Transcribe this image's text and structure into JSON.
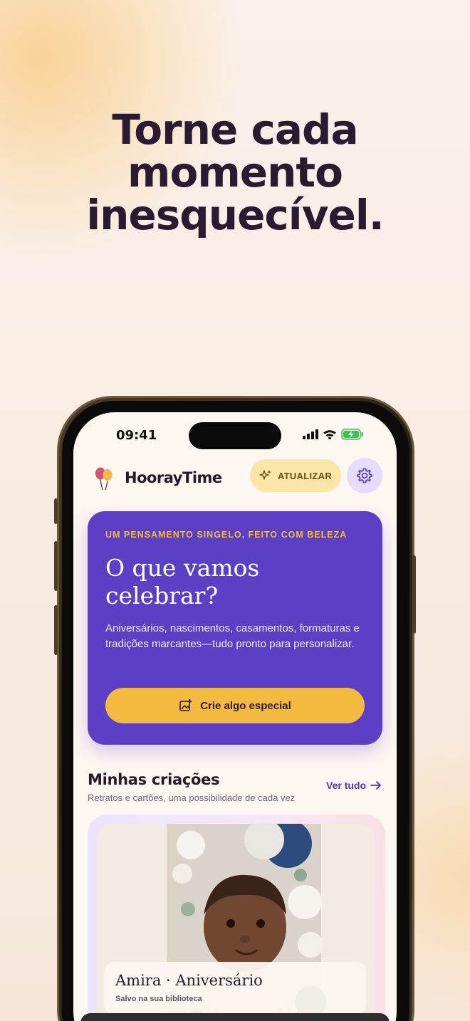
{
  "headline": {
    "line1": "Torne cada",
    "line2": "momento",
    "line3": "inesquecível."
  },
  "status_bar": {
    "time": "09:41"
  },
  "app": {
    "brand": "HoorayTime",
    "upgrade_label": "ATUALIZAR",
    "settings_icon": "gear-icon"
  },
  "hero": {
    "eyebrow": "UM PENSAMENTO SINGELO, FEITO COM BELEZA",
    "title_line1": "O que vamos",
    "title_line2": "celebrar?",
    "description": "Aniversários, nascimentos, casamentos, formaturas e tradições marcantes—tudo pronto para personalizar.",
    "cta_label": "Crie algo especial"
  },
  "creations": {
    "title": "Minhas criações",
    "subtitle": "Retratos e cartões, uma possibilidade de cada vez",
    "see_all": "Ver tudo",
    "card": {
      "title": "Amira · Aniversário",
      "subtitle": "Salvo na sua biblioteca"
    }
  },
  "colors": {
    "primary": "#5b40c6",
    "accent": "#f4b93f",
    "upgrade_bg": "#fbe6a9",
    "settings_bg": "#e6dcff"
  }
}
